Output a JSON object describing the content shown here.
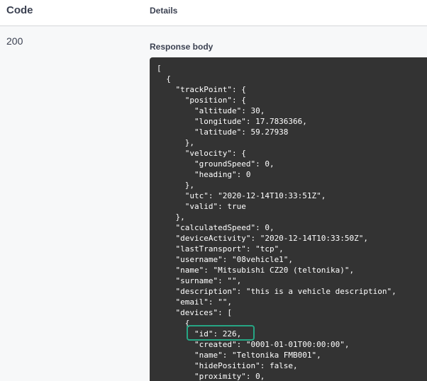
{
  "table": {
    "code_header": "Code",
    "details_header": "Details"
  },
  "response": {
    "status_code": "200",
    "body_label": "Response body",
    "body_lines": [
      "[",
      "  {",
      "    \"trackPoint\": {",
      "      \"position\": {",
      "        \"altitude\": 30,",
      "        \"longitude\": 17.7836366,",
      "        \"latitude\": 59.27938",
      "      },",
      "      \"velocity\": {",
      "        \"groundSpeed\": 0,",
      "        \"heading\": 0",
      "      },",
      "      \"utc\": \"2020-12-14T10:33:51Z\",",
      "      \"valid\": true",
      "    },",
      "    \"calculatedSpeed\": 0,",
      "    \"deviceActivity\": \"2020-12-14T10:33:50Z\",",
      "    \"lastTransport\": \"tcp\",",
      "    \"username\": \"08vehicle1\",",
      "    \"name\": \"Mitsubishi CZ20 (teltonika)\",",
      "    \"surname\": \"\",",
      "    \"description\": \"this is a vehicle description\",",
      "    \"email\": \"\",",
      "    \"devices\": [",
      "      {",
      "        \"id\": 226,",
      "        \"created\": \"0001-01-01T00:00:00\",",
      "        \"name\": \"Teltonika FMB001\",",
      "        \"hidePosition\": false,",
      "        \"proximity\": 0,"
    ]
  },
  "highlight_color": "#26a684",
  "code_background": "#333333"
}
